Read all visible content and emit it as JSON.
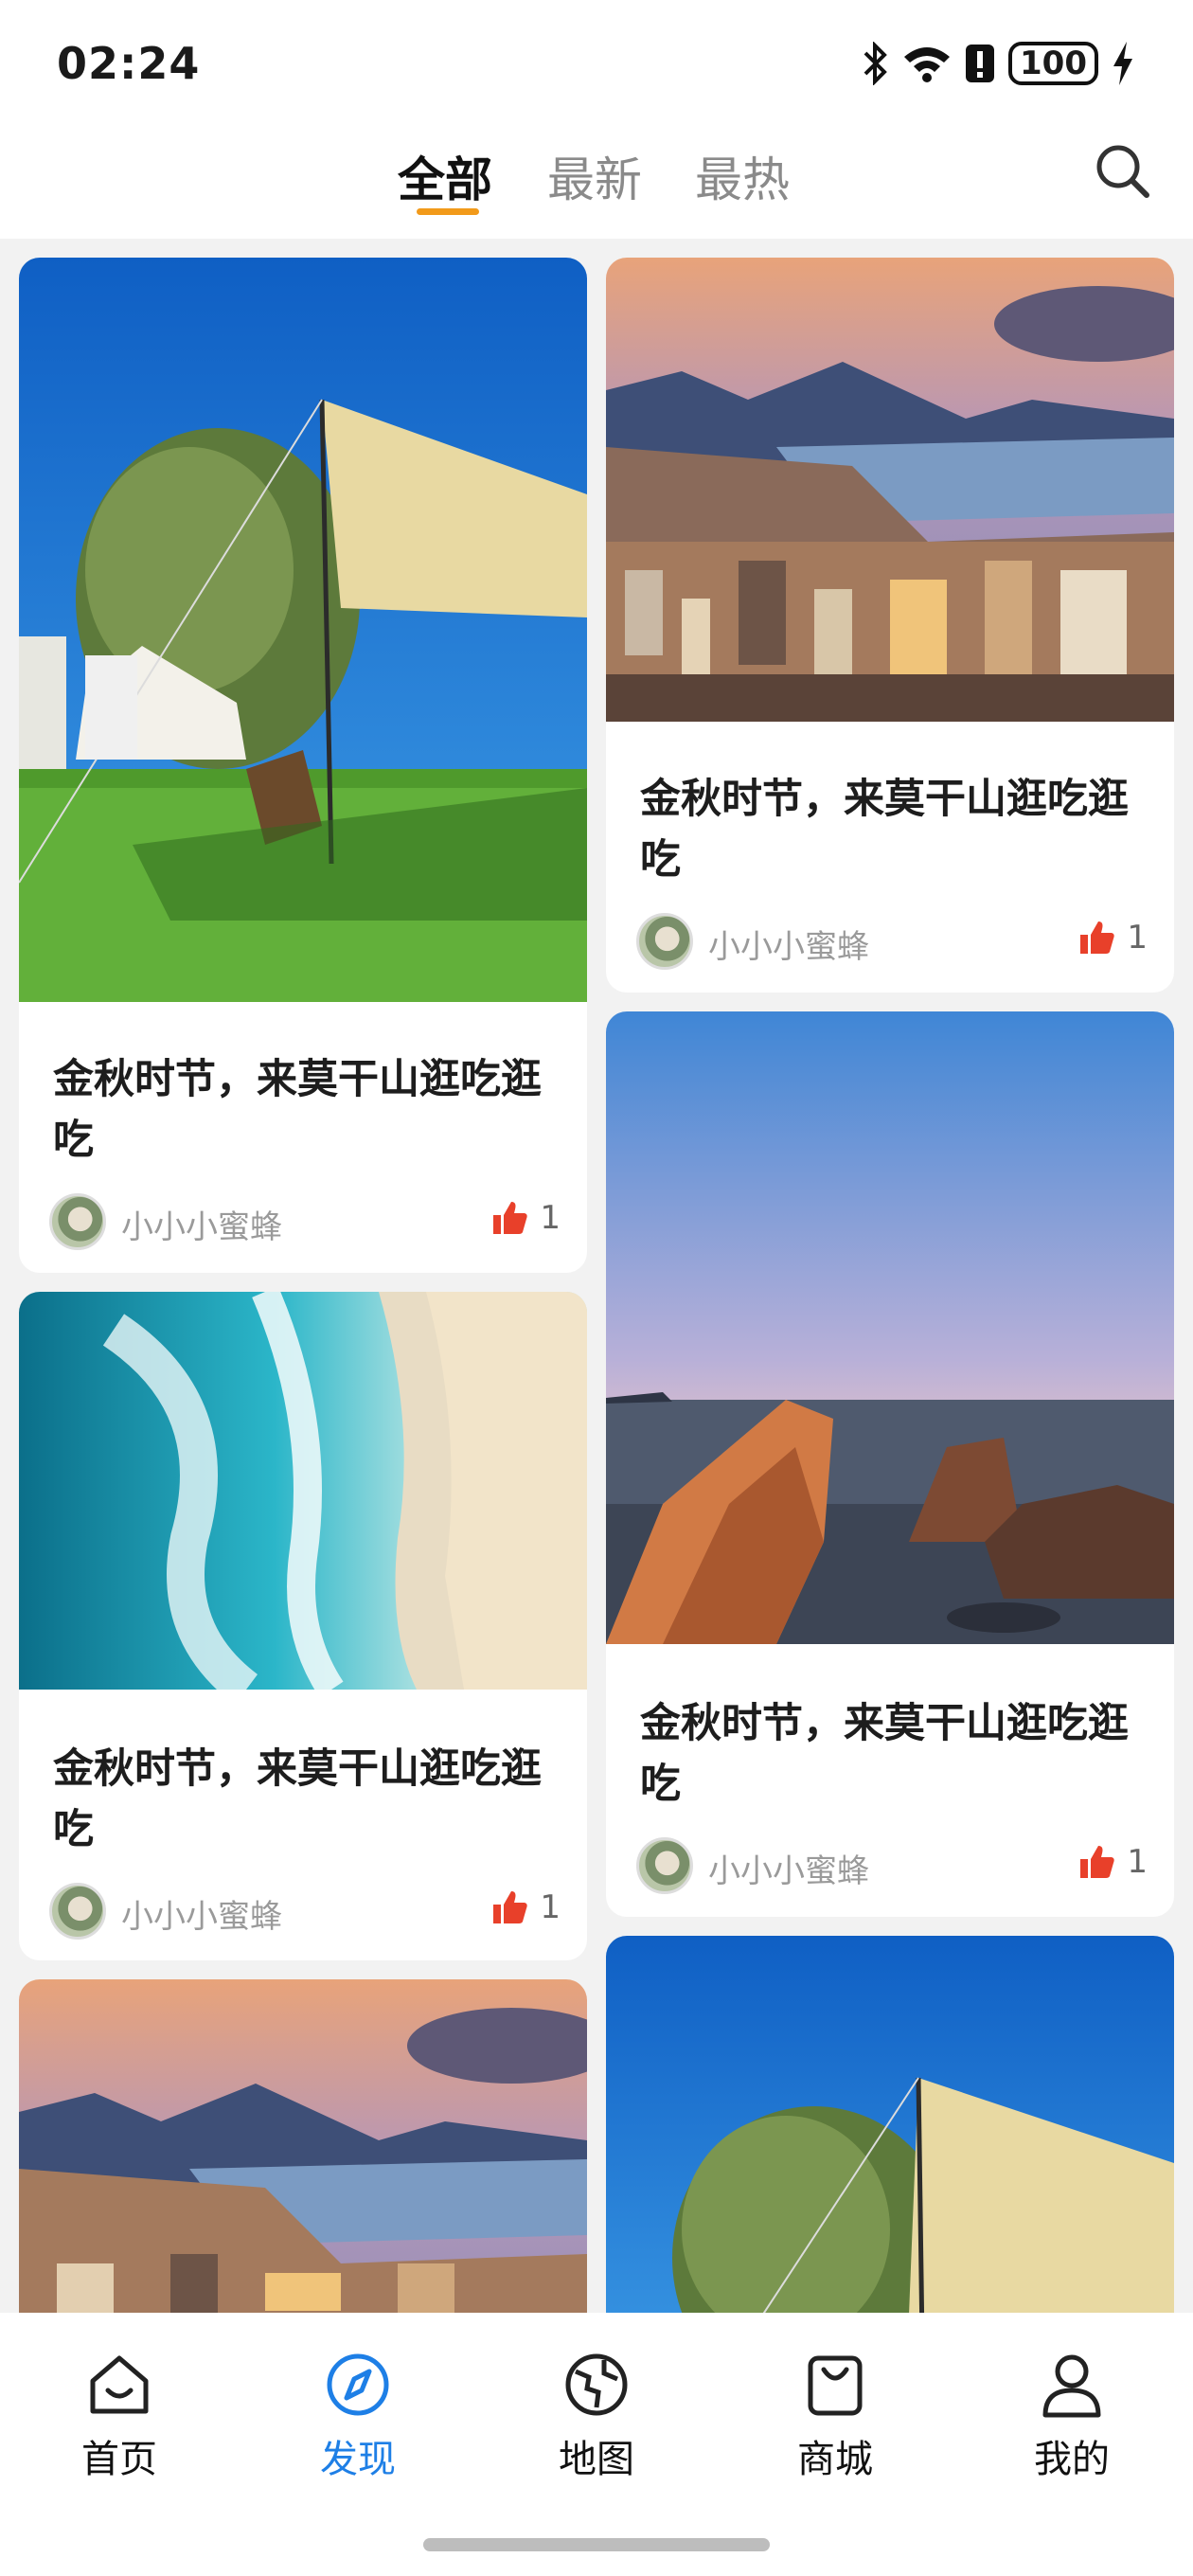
{
  "status_bar": {
    "time": "02:24",
    "battery": "100",
    "icons": [
      "bluetooth-icon",
      "wifi-icon",
      "alert-icon",
      "battery-icon",
      "charging-icon"
    ]
  },
  "tabs": [
    {
      "label": "全部",
      "active": true
    },
    {
      "label": "最新"
    },
    {
      "label": "最热"
    }
  ],
  "search_icon": "search-icon",
  "cards": [
    {
      "title": "金秋时节，来莫干山逛吃逛吃",
      "author": "小小小蜜蜂",
      "likes": "1",
      "image": "camping-tent-meadow"
    },
    {
      "title": "金秋时节，来莫干山逛吃逛吃",
      "author": "小小小蜜蜂",
      "likes": "1",
      "image": "harbor-city-sunset"
    },
    {
      "title": "金秋时节，来莫干山逛吃逛吃",
      "author": "小小小蜜蜂",
      "likes": "1",
      "image": "aerial-beach-waves"
    },
    {
      "title": "金秋时节，来莫干山逛吃逛吃",
      "author": "小小小蜜蜂",
      "likes": "1",
      "image": "sea-rocks-dusk"
    },
    {
      "image": "harbor-city-sunset"
    },
    {
      "image": "camping-tent-meadow"
    }
  ],
  "nav": [
    {
      "label": "首页",
      "icon": "home-icon"
    },
    {
      "label": "发现",
      "icon": "compass-icon",
      "active": true
    },
    {
      "label": "地图",
      "icon": "globe-map-icon"
    },
    {
      "label": "商城",
      "icon": "shopping-bag-icon"
    },
    {
      "label": "我的",
      "icon": "profile-icon"
    }
  ],
  "colors": {
    "accent": "#1e7fe6",
    "tab_underline": "#f29a1a",
    "like": "#e8402a"
  }
}
